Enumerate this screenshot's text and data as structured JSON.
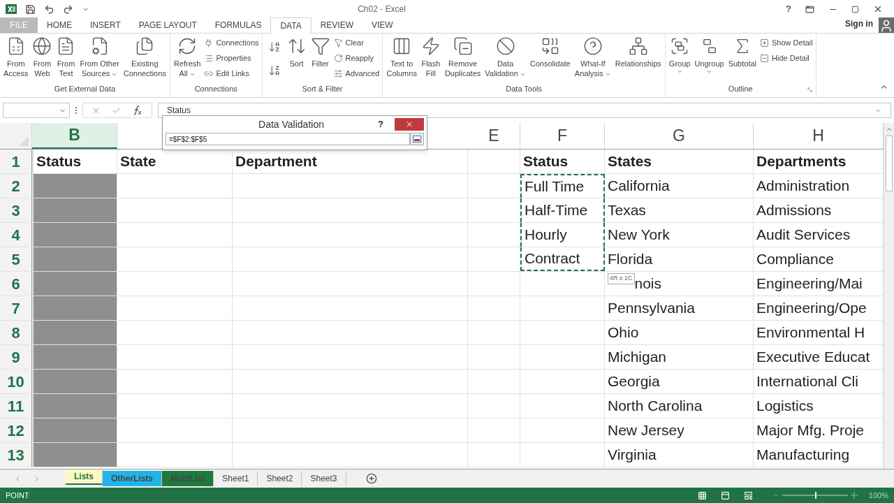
{
  "title_bar": {
    "title": "Ch02 - Excel",
    "help": "?"
  },
  "ribbon_tabs": [
    {
      "label": "FILE",
      "kind": "file",
      "selected": false
    },
    {
      "label": "HOME",
      "kind": "tab",
      "selected": false
    },
    {
      "label": "INSERT",
      "kind": "tab",
      "selected": false
    },
    {
      "label": "PAGE LAYOUT",
      "kind": "tab",
      "selected": false
    },
    {
      "label": "FORMULAS",
      "kind": "tab",
      "selected": false
    },
    {
      "label": "DATA",
      "kind": "tab",
      "selected": true
    },
    {
      "label": "REVIEW",
      "kind": "tab",
      "selected": false
    },
    {
      "label": "VIEW",
      "kind": "tab",
      "selected": false
    }
  ],
  "account": {
    "label": "Sign in"
  },
  "ribbon_groups": [
    {
      "label": "Get External Data",
      "items": [
        {
          "kind": "large",
          "lines": [
            "From",
            "Access"
          ],
          "menu": false
        },
        {
          "kind": "large",
          "lines": [
            "From",
            "Web"
          ],
          "menu": false
        },
        {
          "kind": "large",
          "lines": [
            "From",
            "Text"
          ],
          "menu": false
        },
        {
          "kind": "large",
          "lines": [
            "From Other",
            "Sources"
          ],
          "menu": true
        },
        {
          "kind": "large",
          "lines": [
            "Existing",
            "Connections"
          ],
          "menu": false
        }
      ]
    },
    {
      "label": "Connections",
      "items": [
        {
          "kind": "large",
          "lines": [
            "Refresh",
            "All"
          ],
          "menu": true
        },
        {
          "kind": "stack",
          "buttons": [
            {
              "label": "Connections"
            },
            {
              "label": "Properties"
            },
            {
              "label": "Edit Links"
            }
          ]
        }
      ]
    },
    {
      "label": "Sort & Filter",
      "items": [
        {
          "kind": "sort_pair"
        },
        {
          "kind": "large",
          "lines": [
            "Sort"
          ],
          "menu": false
        },
        {
          "kind": "large",
          "lines": [
            "Filter"
          ],
          "menu": false
        },
        {
          "kind": "stack",
          "buttons": [
            {
              "label": "Clear"
            },
            {
              "label": "Reapply"
            },
            {
              "label": "Advanced"
            }
          ]
        }
      ]
    },
    {
      "label": "Data Tools",
      "items": [
        {
          "kind": "large",
          "lines": [
            "Text to",
            "Columns"
          ],
          "menu": false
        },
        {
          "kind": "large",
          "lines": [
            "Flash",
            "Fill"
          ],
          "menu": false
        },
        {
          "kind": "large",
          "lines": [
            "Remove",
            "Duplicates"
          ],
          "menu": false
        },
        {
          "kind": "large",
          "lines": [
            "Data",
            "Validation"
          ],
          "menu": true
        },
        {
          "kind": "large",
          "lines": [
            "Consolidate"
          ],
          "menu": false
        },
        {
          "kind": "large",
          "lines": [
            "What-If",
            "Analysis"
          ],
          "menu": true
        },
        {
          "kind": "large",
          "lines": [
            "Relationships"
          ],
          "menu": false
        }
      ]
    },
    {
      "label": "Outline",
      "launcher": true,
      "items": [
        {
          "kind": "large",
          "lines": [
            "Group"
          ],
          "menu": true
        },
        {
          "kind": "large",
          "lines": [
            "Ungroup"
          ],
          "menu": true
        },
        {
          "kind": "large",
          "lines": [
            "Subtotal"
          ],
          "menu": false
        },
        {
          "kind": "stack",
          "buttons": [
            {
              "label": "Show Detail"
            },
            {
              "label": "Hide Detail"
            }
          ]
        }
      ]
    }
  ],
  "formula_bar": {
    "value": "Status"
  },
  "dialog": {
    "title": "Data Validation",
    "help": "?",
    "value": "=$F$2:$F$5"
  },
  "columns": [
    {
      "label": "B",
      "selected": true
    },
    {
      "label": "E",
      "selected": false
    },
    {
      "label": "F",
      "selected": false
    },
    {
      "label": "G",
      "selected": false
    },
    {
      "label": "H",
      "selected": false
    }
  ],
  "rows": [
    {
      "number": "1",
      "header": true,
      "marked": false,
      "b": "Status",
      "c": "State",
      "d": "Department",
      "f": "Status",
      "g": "States",
      "h": "Departments"
    },
    {
      "number": "2",
      "header": false,
      "marked": true,
      "f": "Full Time",
      "g": "California",
      "h": "Administration"
    },
    {
      "number": "3",
      "header": false,
      "marked": true,
      "f": "Half-Time",
      "g": "Texas",
      "h": "Admissions"
    },
    {
      "number": "4",
      "header": false,
      "marked": true,
      "f": "Hourly",
      "g": "New York",
      "h": "Audit Services"
    },
    {
      "number": "5",
      "header": false,
      "marked": true,
      "f": "Contract",
      "g": "Florida",
      "h": "Compliance"
    },
    {
      "number": "6",
      "header": false,
      "marked": false,
      "tooltip": "4R x 1C",
      "g": "nois",
      "h": "Engineering/Mai"
    },
    {
      "number": "7",
      "header": false,
      "marked": false,
      "g": "Pennsylvania",
      "h": "Engineering/Ope"
    },
    {
      "number": "8",
      "header": false,
      "marked": false,
      "g": "Ohio",
      "h": "Environmental H"
    },
    {
      "number": "9",
      "header": false,
      "marked": false,
      "g": "Michigan",
      "h": "Executive Educat"
    },
    {
      "number": "10",
      "header": false,
      "marked": false,
      "g": "Georgia",
      "h": "International Cli"
    },
    {
      "number": "11",
      "header": false,
      "marked": false,
      "g": "North Carolina",
      "h": "Logistics"
    },
    {
      "number": "12",
      "header": false,
      "marked": false,
      "g": "New Jersey",
      "h": "Major Mfg. Proje"
    },
    {
      "number": "13",
      "header": false,
      "marked": false,
      "g": "Virginia",
      "h": "Manufacturing"
    }
  ],
  "sheet_tabs": [
    {
      "label": "Lists",
      "selected": true,
      "color": "#fbf8c4"
    },
    {
      "label": "OtherLists",
      "selected": false,
      "color": "#22b4e8"
    },
    {
      "label": "MultiList",
      "selected": false,
      "color": "#1f7a3d"
    },
    {
      "label": "Sheet1",
      "selected": false
    },
    {
      "label": "Sheet2",
      "selected": false
    },
    {
      "label": "Sheet3",
      "selected": false
    }
  ],
  "status_bar": {
    "mode": "POINT",
    "zoom": {
      "level": 0.5,
      "reading": "100%"
    }
  }
}
